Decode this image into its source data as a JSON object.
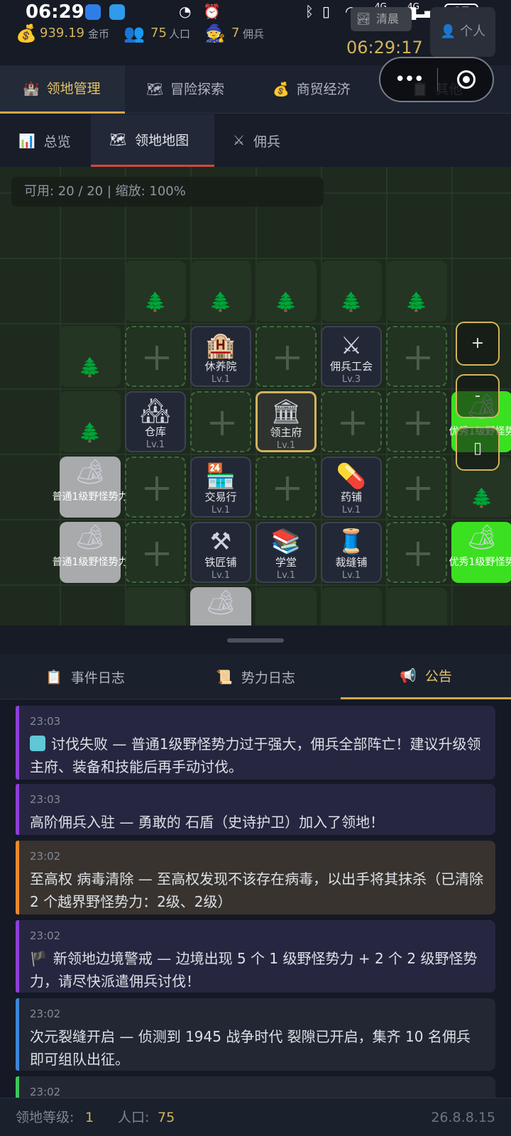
{
  "status_bar": {
    "time": "06:29",
    "battery": "87",
    "network_1": "4G",
    "network_2": "4G"
  },
  "resources": {
    "gold": {
      "value": "939.19",
      "unit": "金币",
      "icon": "money-bag-icon"
    },
    "population": {
      "value": "75",
      "unit": "人口",
      "icon": "people-icon"
    },
    "mercenaries": {
      "value": "7",
      "unit": "佣兵",
      "icon": "warrior-icon"
    }
  },
  "header": {
    "weather": "清晨",
    "profile": "个人",
    "clock": "06:29:17"
  },
  "main_tabs": [
    {
      "label": "领地管理",
      "icon": "castle-icon"
    },
    {
      "label": "冒险探索",
      "icon": "map-icon"
    },
    {
      "label": "商贸经济",
      "icon": "money-bag-icon"
    },
    {
      "label": "其他",
      "icon": "clipboard-icon"
    }
  ],
  "sub_tabs": [
    {
      "label": "总览",
      "icon": "chart-icon"
    },
    {
      "label": "领地地图",
      "icon": "map-icon"
    },
    {
      "label": "佣兵",
      "icon": "crossed-swords-icon"
    }
  ],
  "map": {
    "info": "可用: 20 / 20 | 缩放: 100%",
    "buildings": {
      "rest_house": {
        "name": "休养院",
        "level": "Lv.1"
      },
      "merc_guild": {
        "name": "佣兵工会",
        "level": "Lv.3"
      },
      "warehouse": {
        "name": "仓库",
        "level": "Lv.1"
      },
      "lord_manor": {
        "name": "领主府",
        "level": "Lv.1"
      },
      "trading_post": {
        "name": "交易行",
        "level": "Lv.1"
      },
      "pharmacy": {
        "name": "药铺",
        "level": "Lv.1"
      },
      "blacksmith": {
        "name": "铁匠铺",
        "level": "Lv.1"
      },
      "academy": {
        "name": "学堂",
        "level": "Lv.1"
      },
      "tailor": {
        "name": "裁缝铺",
        "level": "Lv.1"
      }
    },
    "monsters": {
      "normal_1": "普通1级野怪势力",
      "normal_2": "普通1级野怪势力",
      "elite_1": "优秀1级野怪势",
      "elite_2": "优秀1级野怪势"
    },
    "zoom_in": "+",
    "zoom_out": "-"
  },
  "log_tabs": [
    {
      "label": "事件日志",
      "icon": "clipboard-icon"
    },
    {
      "label": "势力日志",
      "icon": "scroll-icon"
    },
    {
      "label": "公告",
      "icon": "megaphone-icon"
    }
  ],
  "logs": [
    {
      "time": "23:03",
      "text": "讨伐失败 — 普通1级野怪势力过于强大，佣兵全部阵亡！建议升级领主府、装备和技能后再手动讨伐。",
      "color": "#8e3fd8"
    },
    {
      "time": "23:03",
      "text": "高阶佣兵入驻 — 勇敢的 石盾（史诗护卫）加入了领地！",
      "color": "#8e3fd8"
    },
    {
      "time": "23:02",
      "text": "至高权 病毒清除 — 至高权发现不该存在病毒，以出手将其抹杀（已清除 2 个越界野怪势力：2级、2级）",
      "color": "#e8892a"
    },
    {
      "time": "23:02",
      "text": "新领地边境警戒 — 边境出现 5 个 1 级野怪势力 + 2 个 2 级野怪势力，请尽快派遣佣兵讨伐！",
      "color": "#8e3fd8"
    },
    {
      "time": "23:02",
      "text": "次元裂缝开启 — 侦测到 1945 战争时代 裂隙已开启，集齐 10 名佣兵即可组队出征。",
      "color": "#3d86d6"
    },
    {
      "time": "23:02",
      "text": "",
      "color": "#3cc65a"
    }
  ],
  "footer": {
    "level_label": "领地等级:",
    "level_value": "1",
    "pop_label": "人口:",
    "pop_value": "75",
    "version": "26.8.8.15"
  }
}
